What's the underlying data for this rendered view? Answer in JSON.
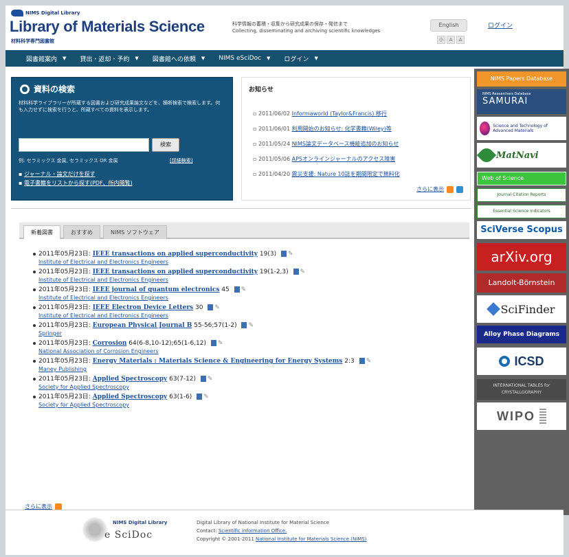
{
  "header": {
    "small_logo": "NIMS Digital Library",
    "title": "Library of Materials Science",
    "subtitle": "材料科学専門図書館",
    "tagline_jp": "科学情報の蓄積・収集から研究成果の保存・発信まで",
    "tagline_en": "Collecting, disseminating and archiving scientific knowledges",
    "lang_button": "English",
    "font_small": "小",
    "font_medium": "A",
    "font_large": "A",
    "login_link": "ログイン"
  },
  "nav": {
    "items": [
      {
        "label": "図書館案内"
      },
      {
        "label": "貸出・返却・予約"
      },
      {
        "label": "図書館への依頼"
      },
      {
        "label": "NIMS eSciDoc"
      },
      {
        "label": "ログイン"
      }
    ],
    "caret": "▼"
  },
  "search": {
    "title": "資料の検索",
    "description": "材料科学ライブラリーが所蔵する図書および研究成果論文などを、横断検索で検索します。何も入力せずに検索を行うと、所蔵すべての資料を表示します。",
    "input_value": "",
    "input_placeholder": "",
    "button_label": "検索",
    "example": "例: セラミックス 金属, セラミックス OR 金属",
    "advanced_link": "[詳細検索]",
    "links": [
      "ジャーナル・論文だけを探す",
      "電子書籍をリストから探す(PDF、所内閲覧)"
    ]
  },
  "news": {
    "title": "お知らせ",
    "items": [
      {
        "date": "2011/06/02",
        "text": "Informaworld (Taylor&Francis) 移行"
      },
      {
        "date": "2011/06/01",
        "text": "利用開始のお知らせ: 化学書籍(Wiley)等"
      },
      {
        "date": "2011/05/24",
        "text": "NIMS論文データベース機能追加のお知らせ"
      },
      {
        "date": "2011/05/06",
        "text": "APSオンラインジャーナルのアクセス障害"
      },
      {
        "date": "2011/04/20",
        "text": "震災支援: Nature 10誌を期間限定で無料化"
      }
    ],
    "more": "さらに表示"
  },
  "tabs": {
    "items": [
      {
        "label": "新着図書"
      },
      {
        "label": "おすすめ"
      },
      {
        "label": "NIMS ソフトウェア"
      }
    ]
  },
  "books": [
    {
      "date": "2011年05月23日:",
      "title": "IEEE transactions on applied superconductivity",
      "vol": "19(3)",
      "publisher": "Institute of Electrical and Electronics Engineers"
    },
    {
      "date": "2011年05月23日:",
      "title": "IEEE transactions on applied superconductivity",
      "vol": "19(1-2,3)",
      "publisher": "Institute of Electrical and Electronics Engineers"
    },
    {
      "date": "2011年05月23日:",
      "title": "IEEE journal of quantum electronics",
      "vol": "45",
      "publisher": "Institute of Electrical and Electronics Engineers"
    },
    {
      "date": "2011年05月23日:",
      "title": "IEEE Electron Device Letters",
      "vol": "30",
      "publisher": "Institute of Electrical and Electronics Engineers"
    },
    {
      "date": "2011年05月23日:",
      "title": "European Physical Journal B",
      "vol": "55-56;57(1-2)",
      "publisher": "Springer"
    },
    {
      "date": "2011年05月23日:",
      "title": "Corrosion",
      "vol": "64(6-8,10-12);65(1-6,12)",
      "publisher": "National Association of Corrosion Engineers"
    },
    {
      "date": "2011年05月23日:",
      "title": "Energy Materials : Materials Science & Engineering for Energy Systems",
      "vol": "2:3",
      "publisher": "Maney Publishing"
    },
    {
      "date": "2011年05月23日:",
      "title": "Applied Spectroscopy",
      "vol": "63(7-12)",
      "publisher": "Society for Applied Spectroscopy"
    },
    {
      "date": "2011年05月23日:",
      "title": "Applied Spectroscopy",
      "vol": "63(1-6)",
      "publisher": "Society for Applied Spectroscopy"
    }
  ],
  "books_more": "さらに表示",
  "sidebar": {
    "items": [
      {
        "label": "NIMS Papers Database"
      },
      {
        "label_small": "NIMS Researchers Database",
        "label": "SAMURAI"
      },
      {
        "label": "Science and Technology of Advanced Materials"
      },
      {
        "label": "MatNavi"
      },
      {
        "label": "Web of Science"
      },
      {
        "label": "Journal Citation Reports"
      },
      {
        "label": "Essential Science Indicators"
      },
      {
        "label": "SciVerse Scopus"
      },
      {
        "label": "arXiv.org"
      },
      {
        "label": "Landolt-Börnstein"
      },
      {
        "label": "SciFinder"
      },
      {
        "label": "Alloy Phase Diagrams"
      },
      {
        "label": "ICSD"
      },
      {
        "label": "INTERNATIONAL TABLES for CRYSTALLOGRAPHY"
      },
      {
        "label": "WIPO"
      }
    ]
  },
  "footer": {
    "logo_small": "NIMS Digital Library",
    "logo_big": "e SciDoc",
    "line1": "Digital Library of National Institute for Material Science",
    "contact_label": "Contact:",
    "contact_link": "Scientific Information Office.",
    "copyright": "Copyright © 2001-2011",
    "copyright_link": "National Institute for Materials Science (NIMS)"
  },
  "colors": {
    "nav_bg": "#15516f",
    "search_bg": "#15537a",
    "sidebar_bg": "#616161",
    "link": "#1a4f9c"
  }
}
